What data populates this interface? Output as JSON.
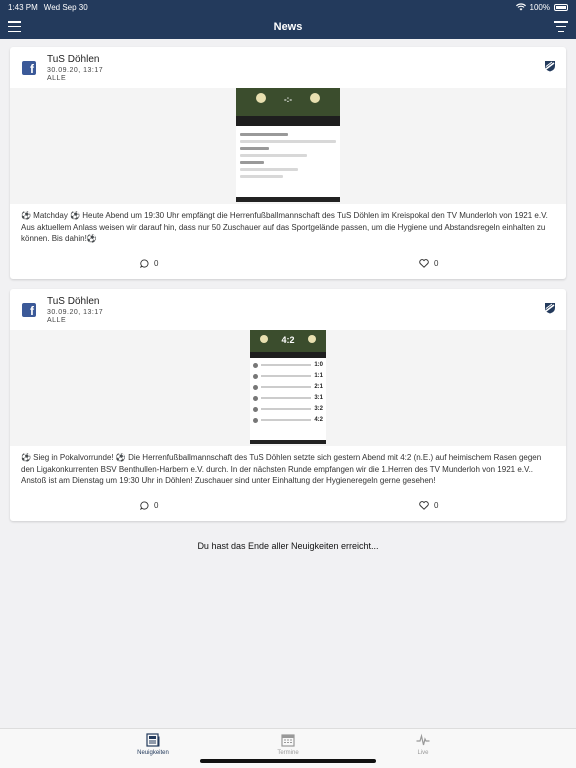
{
  "statusbar": {
    "time": "1:43 PM",
    "date": "Wed Sep 30",
    "battery": "100%"
  },
  "navbar": {
    "title": "News"
  },
  "posts": [
    {
      "author": "TuS Döhlen",
      "date": "30.09.20, 13:17",
      "category": "ALLE",
      "text": "⚽ Matchday ⚽ Heute Abend um 19:30 Uhr empfängt die Herrenfußballmannschaft des TuS Döhlen im Kreispokal den TV Munderloh von 1921 e.V. Aus aktuellem Anlass weisen wir darauf hin, dass nur 50 Zuschauer auf das Sportgelände passen, um die Hygiene und Abstandsregeln einhalten zu können. Bis dahin!⚽",
      "comments": "0",
      "likes": "0",
      "image_score": "-:-"
    },
    {
      "author": "TuS Döhlen",
      "date": "30.09.20, 13:17",
      "category": "ALLE",
      "text": "⚽ Sieg in Pokalvorrunde! ⚽ Die Herrenfußballmannschaft des TuS Döhlen setzte sich gestern Abend mit 4:2 (n.E.) auf heimischem Rasen gegen den Ligakonkurrenten BSV Benthullen-Harbern e.V. durch. In der nächsten Runde empfangen wir die 1.Herren des TV Munderloh von 1921 e.V.. Anstoß ist am Dienstag um 19:30 Uhr in Döhlen! Zuschauer sind unter Einhaltung der Hygieneregeln gerne gesehen!",
      "comments": "0",
      "likes": "0",
      "image_score": "4:2",
      "image_rows": [
        "1:0",
        "1:1",
        "2:1",
        "3:1",
        "3:2",
        "4:2"
      ]
    }
  ],
  "end_message": "Du hast das Ende aller Neuigkeiten erreicht...",
  "tabbar": {
    "news": "Neuigkeiten",
    "events": "Termine",
    "live": "Live"
  },
  "colors": {
    "primary": "#233a5c",
    "facebook": "#3b5998"
  }
}
